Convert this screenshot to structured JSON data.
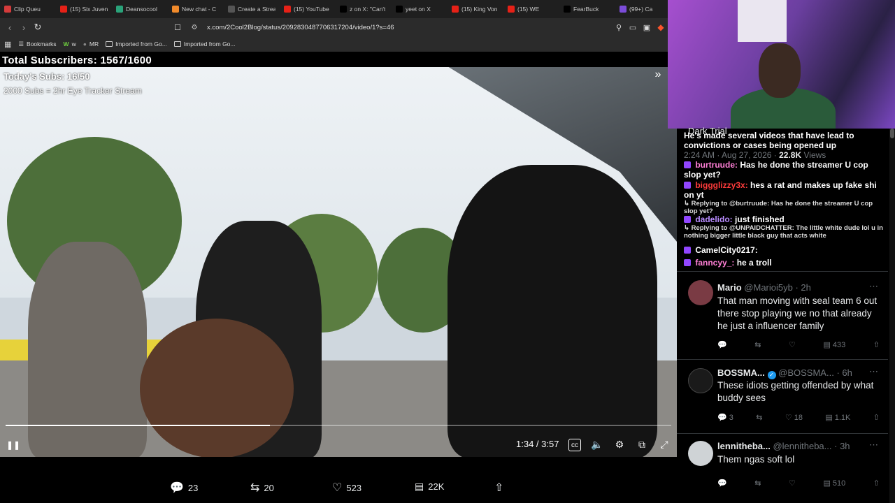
{
  "browser": {
    "tabs": [
      {
        "label": "Clip Queu",
        "color": "#d43b3b"
      },
      {
        "label": "(15) Six Juven",
        "color": "#e62117"
      },
      {
        "label": "Deansocool",
        "color": "#2aa37a"
      },
      {
        "label": "New chat - C",
        "color": "#f08a2b"
      },
      {
        "label": "Create a Strea",
        "color": "#555555"
      },
      {
        "label": "(15) YouTube",
        "color": "#e62117"
      },
      {
        "label": "z on X: \"Can't",
        "color": "#000000"
      },
      {
        "label": "yeet on X",
        "color": "#000000"
      },
      {
        "label": "(15) King Von",
        "color": "#e62117"
      },
      {
        "label": "(15) WE",
        "color": "#e62117"
      },
      {
        "label": "FearBuck",
        "color": "#000000"
      },
      {
        "label": "(99+) Ca",
        "color": "#7b4cd9"
      }
    ],
    "url": "x.com/2Cool2Blog/status/2092830487706317204/video/1?s=46",
    "bookmarks": [
      {
        "label": "Bookmarks",
        "icon": "bookmarks-icon"
      },
      {
        "label": "w",
        "icon": "w-icon"
      },
      {
        "label": "MR",
        "icon": "mr-icon"
      },
      {
        "label": "Imported from Go...",
        "icon": "folder-icon"
      },
      {
        "label": "Imported from Go...",
        "icon": "folder-icon"
      }
    ]
  },
  "overlay": {
    "total_subscribers": "Total Subscribers: 1567/1600",
    "todays_subs": "Today's Subs: 16/50",
    "eye_tracker": "2000 Subs = 2hr Eye Tracker Stream"
  },
  "video": {
    "time": "1:34 / 3:57",
    "progress": 0.397
  },
  "tweet_actions": {
    "replies": "23",
    "reposts": "20",
    "likes": "523",
    "views": "22K"
  },
  "chat": {
    "lines": [
      {
        "user": "",
        "text": "He's made several videos that have lead to convictions or cases being opened up",
        "color": "#ffffff"
      },
      {
        "user": "burtruude:",
        "text": "Has he done the streamer U cop slop yet?",
        "color": "#ff7fd6"
      },
      {
        "user": "biggglizzy3x:",
        "text": "hes a rat and makes up fake shi on yt",
        "color": "#ff3b3b"
      },
      {
        "user": "dadelido:",
        "text": "just finished",
        "color": "#b98cff"
      },
      {
        "user": "CamelCity0217:",
        "text": "",
        "color": "#ffffff"
      },
      {
        "user": "fanncyy_:",
        "text": "he a troll",
        "color": "#ff7fd6"
      }
    ],
    "reply_notes": [
      "↳ Replying to @burtruude: Has he done the streamer U cop slop yet?",
      "↳ Replying to @UNPAIDCHATTER: The little white dude lol u in nothing bigger little black guy that acts white"
    ],
    "ghost_date": "2:24 AM · Aug 27, 2026 ·",
    "ghost_views": "22.8K",
    "ghost_views_label": "Views",
    "ghost_header": "Dark Trial"
  },
  "tweets": [
    {
      "name": "Mario",
      "handle": "@Marioi5yb",
      "time": "· 2h",
      "text": "That man moving with seal team 6 out there stop playing we no that already he just a influencer family",
      "replies": "",
      "reposts": "",
      "likes": "",
      "views": "433",
      "avatar_color": "#7a3b44"
    },
    {
      "name": "BOSSMA...",
      "handle": "@BOSSMA...",
      "time": "· 6h",
      "verified": true,
      "text": "These idiots getting offended by what buddy sees",
      "replies": "3",
      "reposts": "",
      "likes": "18",
      "views": "1.1K",
      "avatar_color": "#1a1a1a"
    },
    {
      "name": "lennitheba...",
      "handle": "@lennitheba...",
      "time": "· 3h",
      "text": "Them ngas soft lol",
      "replies": "",
      "reposts": "",
      "likes": "",
      "views": "510",
      "avatar_color": "#cfd3d6"
    }
  ]
}
